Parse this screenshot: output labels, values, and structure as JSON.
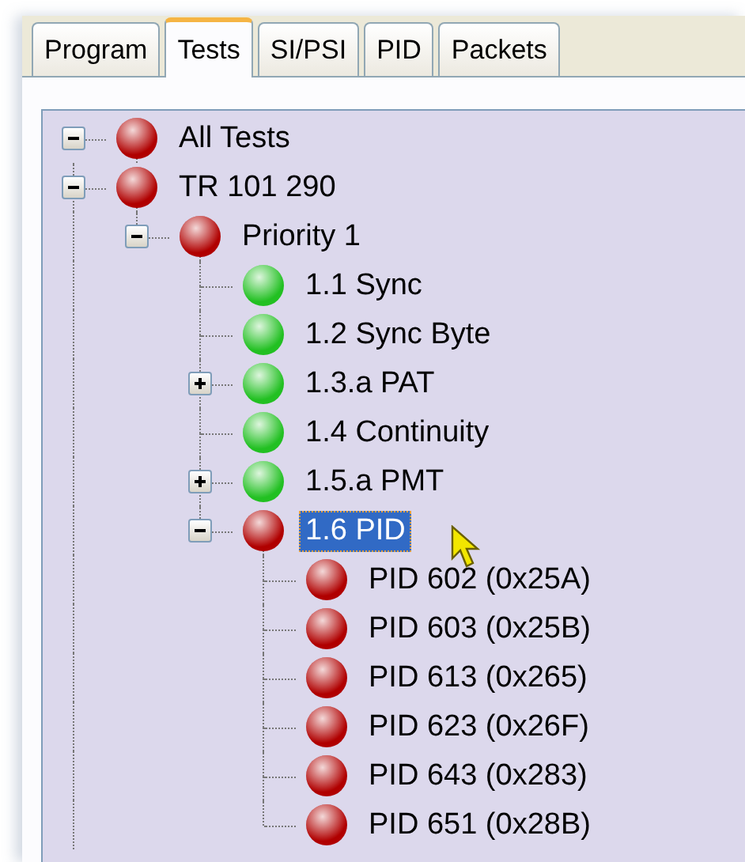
{
  "tabs": [
    {
      "label": "Program",
      "selected": false
    },
    {
      "label": "Tests",
      "selected": true
    },
    {
      "label": "SI/PSI",
      "selected": false
    },
    {
      "label": "PID",
      "selected": false
    },
    {
      "label": "Packets",
      "selected": false
    }
  ],
  "tree": [
    {
      "label": "All Tests",
      "color": "#b00000",
      "expanded": true,
      "selected": false,
      "children": [
        {
          "label": "TR 101 290",
          "color": "#b00000",
          "expanded": true,
          "selected": false,
          "children": [
            {
              "label": "Priority 1",
              "color": "#b00000",
              "expanded": true,
              "selected": false,
              "children": [
                {
                  "label": "1.1 Sync",
                  "color": "#22c022",
                  "selected": false
                },
                {
                  "label": "1.2 Sync Byte",
                  "color": "#22c022",
                  "selected": false
                },
                {
                  "label": "1.3.a PAT",
                  "color": "#22c022",
                  "expanded": false,
                  "selected": false
                },
                {
                  "label": "1.4 Continuity",
                  "color": "#22c022",
                  "selected": false
                },
                {
                  "label": "1.5.a PMT",
                  "color": "#22c022",
                  "expanded": false,
                  "selected": false
                },
                {
                  "label": "1.6 PID",
                  "color": "#b00000",
                  "expanded": true,
                  "selected": true,
                  "children": [
                    {
                      "label": "PID 602 (0x25A)",
                      "color": "#b00000",
                      "selected": false
                    },
                    {
                      "label": "PID 603 (0x25B)",
                      "color": "#b00000",
                      "selected": false
                    },
                    {
                      "label": "PID 613 (0x265)",
                      "color": "#b00000",
                      "selected": false
                    },
                    {
                      "label": "PID 623 (0x26F)",
                      "color": "#b00000",
                      "selected": false
                    },
                    {
                      "label": "PID 643 (0x283)",
                      "color": "#b00000",
                      "selected": false
                    },
                    {
                      "label": "PID 651 (0x28B)",
                      "color": "#b00000",
                      "selected": false
                    }
                  ]
                }
              ]
            }
          ]
        }
      ]
    }
  ]
}
